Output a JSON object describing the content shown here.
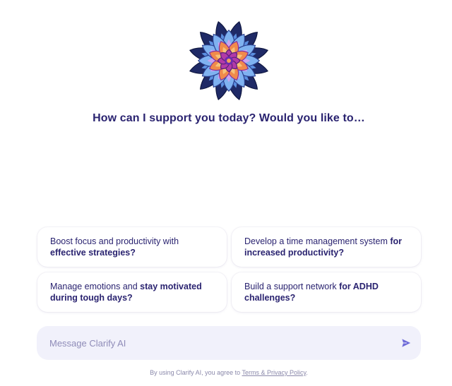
{
  "logo": {
    "icon": "mandala-logo-icon"
  },
  "headline": "How can I support you today? Would you like to…",
  "suggestions": [
    {
      "pre": "Boost focus and productivity with ",
      "bold": "effective strategies?"
    },
    {
      "pre": "Develop a time management system ",
      "bold": "for increased productivity?"
    },
    {
      "pre": "Manage emotions and ",
      "bold": "stay motivated during tough days?"
    },
    {
      "pre": "Build a support network ",
      "bold": "for ADHD challenges?"
    }
  ],
  "composer": {
    "placeholder": "Message Clarify AI",
    "value": "",
    "send_icon": "send-icon"
  },
  "legal": {
    "prefix": "By using Clarify AI, you agree to ",
    "link": "Terms & Privacy Policy",
    "suffix": "."
  },
  "colors": {
    "text": "#2a2370",
    "composer_bg": "#f1f1fb",
    "send": "#6f6bd8",
    "muted": "#8a88aa"
  }
}
